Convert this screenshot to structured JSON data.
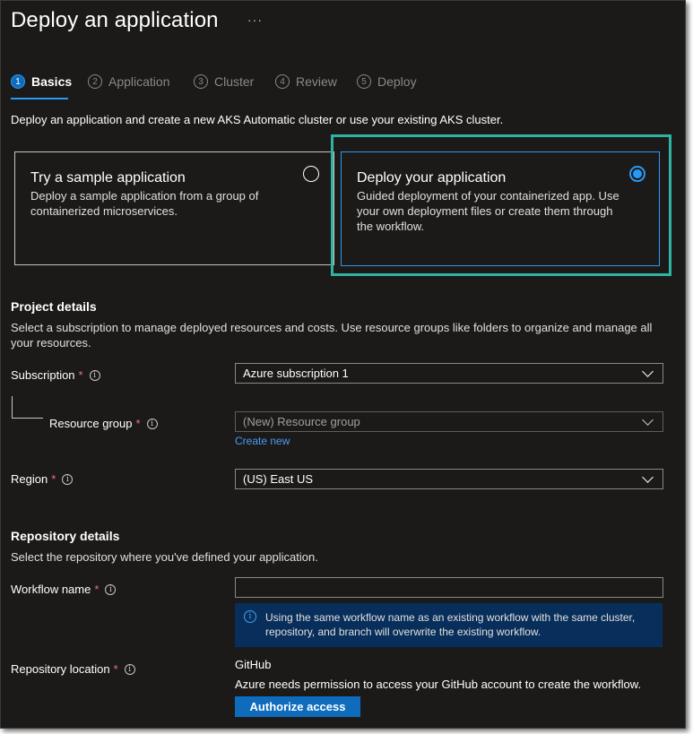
{
  "header": {
    "title": "Deploy an application",
    "more_label": "···"
  },
  "steps": [
    {
      "number": "1",
      "label": "Basics",
      "active": true
    },
    {
      "number": "2",
      "label": "Application",
      "active": false
    },
    {
      "number": "3",
      "label": "Cluster",
      "active": false
    },
    {
      "number": "4",
      "label": "Review",
      "active": false
    },
    {
      "number": "5",
      "label": "Deploy",
      "active": false
    }
  ],
  "intro": "Deploy an application and create a new AKS Automatic cluster or use your existing AKS cluster.",
  "options": [
    {
      "title": "Try a sample application",
      "description": "Deploy a sample application from a group of containerized microservices.",
      "selected": false
    },
    {
      "title": "Deploy your application",
      "description": "Guided deployment of your containerized app. Use your own deployment files or create them through the workflow.",
      "selected": true
    }
  ],
  "project": {
    "title": "Project details",
    "description": "Select a subscription to manage deployed resources and costs. Use resource groups like folders to organize and manage all your resources.",
    "subscription": {
      "label": "Subscription",
      "required": "*",
      "value": "Azure subscription 1"
    },
    "resource_group": {
      "label": "Resource group",
      "required": "*",
      "placeholder": "(New) Resource group",
      "create_new": "Create new"
    },
    "region": {
      "label": "Region",
      "required": "*",
      "value": "(US) East US"
    }
  },
  "repository": {
    "title": "Repository details",
    "description": "Select the repository where you've defined your application.",
    "workflow_name": {
      "label": "Workflow name",
      "required": "*",
      "value": ""
    },
    "info_message": "Using the same workflow name as an existing workflow with the same cluster, repository, and branch will overwrite the existing workflow.",
    "location": {
      "label": "Repository location",
      "required": "*",
      "provider": "GitHub",
      "permission_text": "Azure needs permission to access your GitHub account to create the workflow.",
      "button_label": "Authorize access"
    }
  },
  "icons": {
    "info": "i",
    "chevron": "chevron-down-icon"
  },
  "colors": {
    "accent": "#2899f5",
    "highlight": "#2fb4a1",
    "required": "#f1707b",
    "info_bar": "#082f5b",
    "button": "#0f6cbd"
  }
}
